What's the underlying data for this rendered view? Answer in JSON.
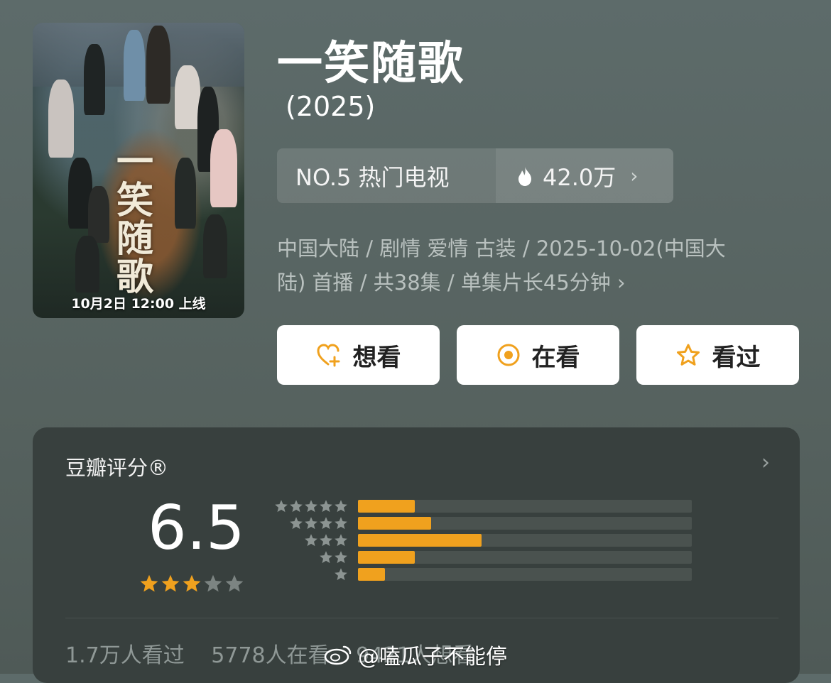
{
  "poster": {
    "calligraphy": "一笑随歌",
    "release_note": "10月2日 12:00 上线"
  },
  "header": {
    "title": "一笑随歌",
    "year": "(2025)"
  },
  "rank": {
    "label": "NO.5 热门电视",
    "heat": "42.0万"
  },
  "meta": {
    "line1": "中国大陆 / 剧情 爱情 古装 / 2025-10-02(中国大",
    "line2": "陆) 首播 / 共38集 / 单集片长45分钟"
  },
  "actions": {
    "want": "想看",
    "watching": "在看",
    "watched": "看过"
  },
  "rating": {
    "label": "豆瓣评分®",
    "score": "6.5",
    "stars_filled": 3,
    "stars_total": 5,
    "distribution": [
      {
        "stars": 5,
        "fraction": 0.17
      },
      {
        "stars": 4,
        "fraction": 0.22
      },
      {
        "stars": 3,
        "fraction": 0.37
      },
      {
        "stars": 2,
        "fraction": 0.17
      },
      {
        "stars": 1,
        "fraction": 0.08
      }
    ],
    "stats": {
      "watched": "1.7万人看过",
      "watching": "5778人在看",
      "want": "9421人想看"
    }
  },
  "watermark": "@嗑瓜子不能停",
  "colors": {
    "accent": "#f0a11e",
    "background": "#5b6866",
    "card": "#38403e"
  }
}
